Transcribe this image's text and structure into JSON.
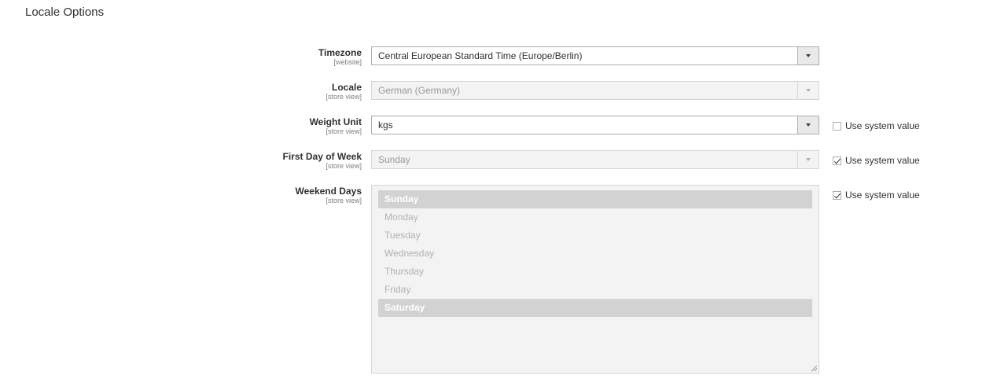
{
  "section": {
    "title": "Locale Options"
  },
  "system_value_label": "Use system value",
  "fields": {
    "timezone": {
      "label": "Timezone",
      "scope": "[website]",
      "value": "Central European Standard Time (Europe/Berlin)"
    },
    "locale": {
      "label": "Locale",
      "scope": "[store view]",
      "value": "German (Germany)"
    },
    "weight_unit": {
      "label": "Weight Unit",
      "scope": "[store view]",
      "value": "kgs",
      "use_system": false
    },
    "first_day": {
      "label": "First Day of Week",
      "scope": "[store view]",
      "value": "Sunday",
      "use_system": true
    },
    "weekend_days": {
      "label": "Weekend Days",
      "scope": "[store view]",
      "use_system": true,
      "options": [
        "Sunday",
        "Monday",
        "Tuesday",
        "Wednesday",
        "Thursday",
        "Friday",
        "Saturday"
      ],
      "selected": [
        "Sunday",
        "Saturday"
      ]
    }
  }
}
